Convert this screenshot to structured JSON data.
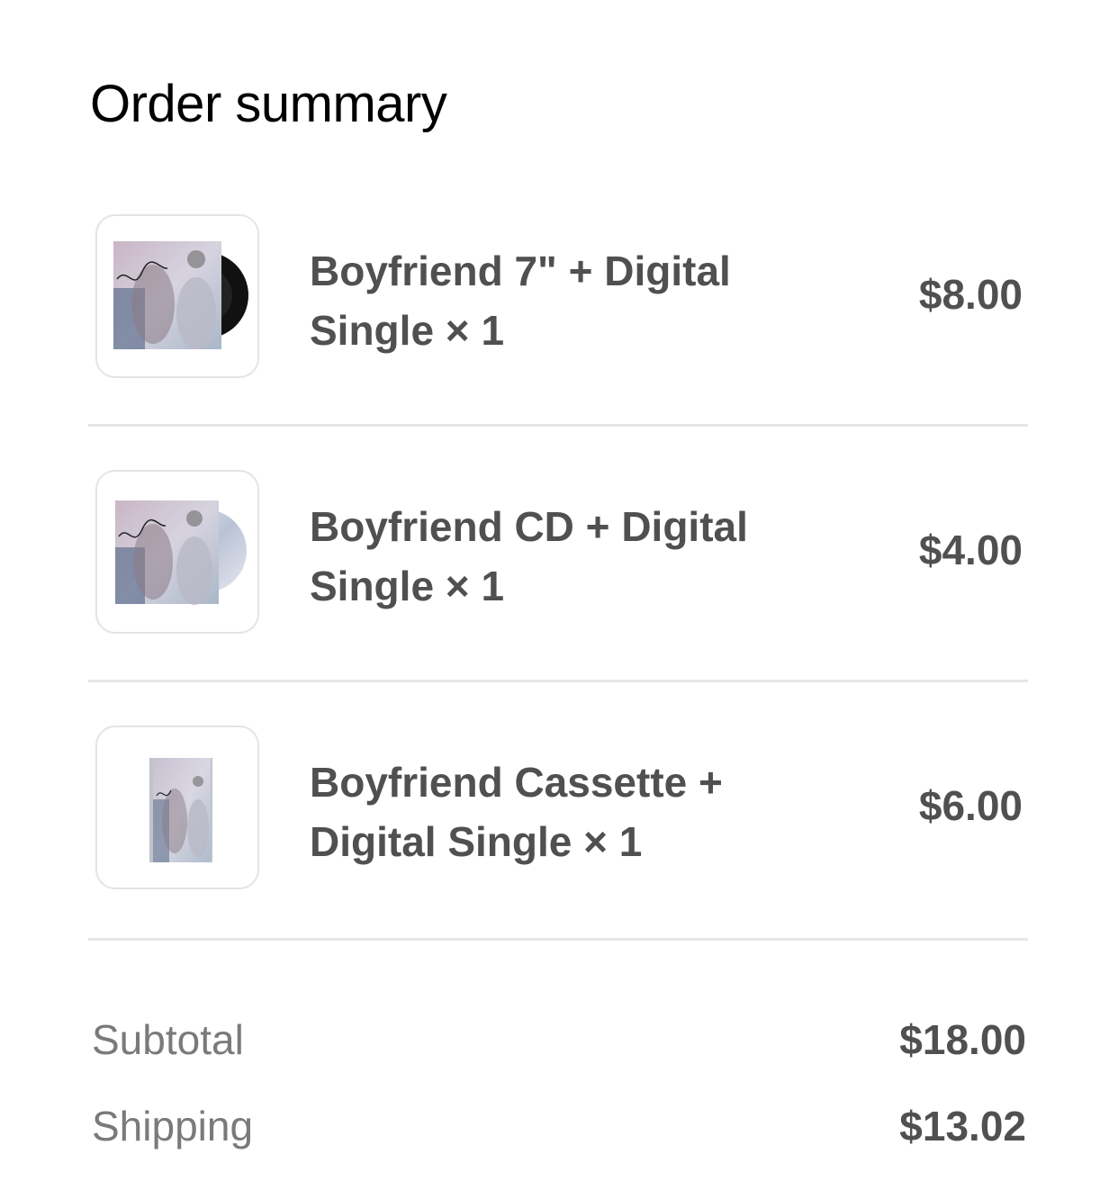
{
  "order_summary": {
    "title": "Order summary",
    "items": [
      {
        "name_line1": "Boyfriend 7\" + Digital",
        "name_line2": "Single × 1",
        "price": "$8.00",
        "thumbnail": "vinyl-record-with-album-art"
      },
      {
        "name_line1": "Boyfriend CD + Digital",
        "name_line2": "Single × 1",
        "price": "$4.00",
        "thumbnail": "cd-with-album-art"
      },
      {
        "name_line1": "Boyfriend Cassette +",
        "name_line2": "Digital Single × 1",
        "price": "$6.00",
        "thumbnail": "cassette-with-album-art"
      }
    ],
    "subtotal_label": "Subtotal",
    "subtotal_value": "$18.00",
    "shipping_label": "Shipping",
    "shipping_value": "$13.02"
  }
}
